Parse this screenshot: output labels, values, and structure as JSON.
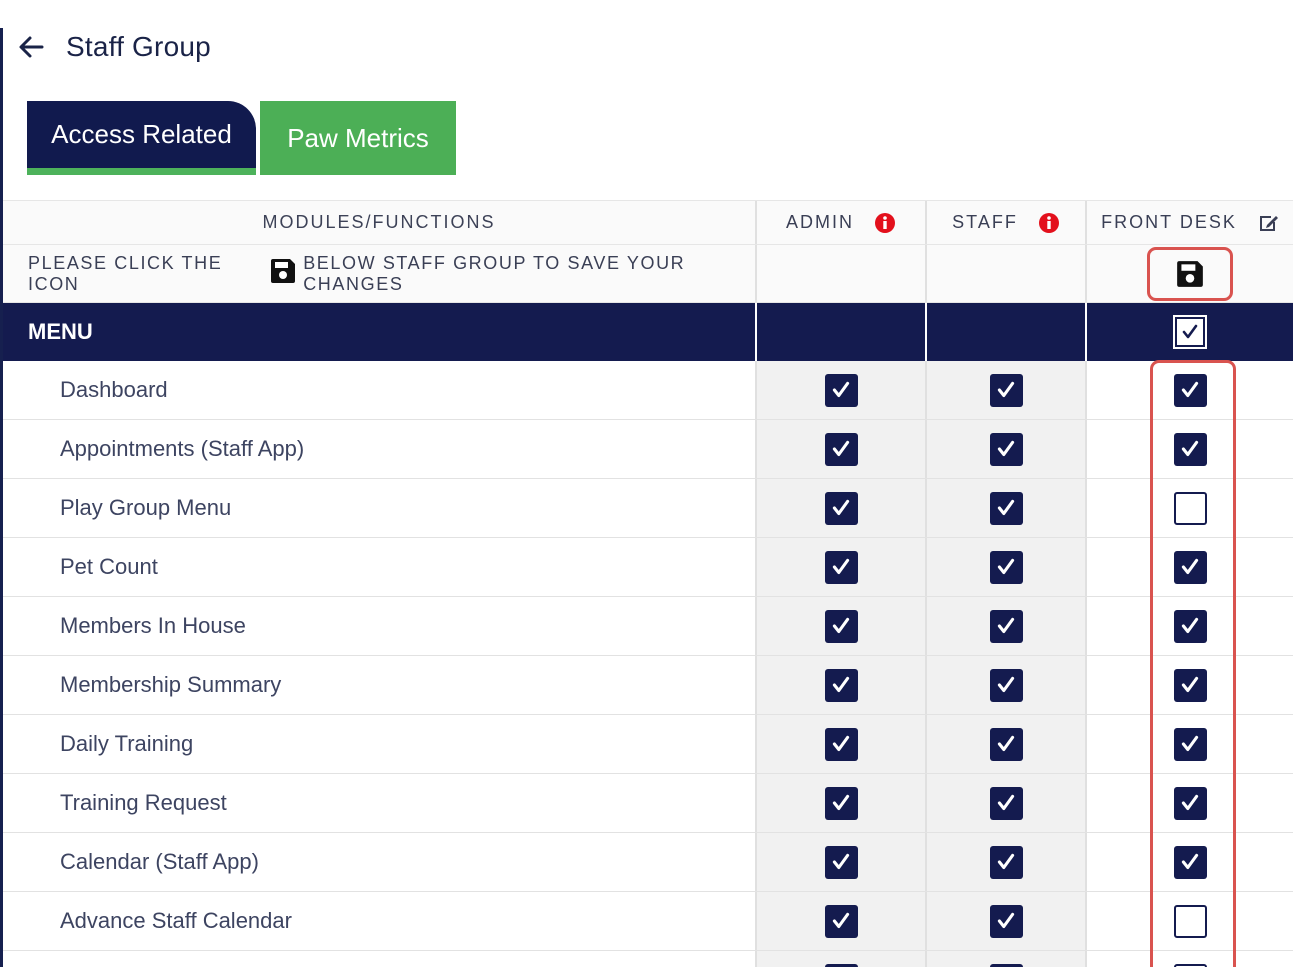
{
  "page": {
    "title": "Staff Group",
    "back_icon": "arrow-left-icon"
  },
  "tabs": [
    {
      "label": "Access Related",
      "active": true,
      "color": "#111a4e"
    },
    {
      "label": "Paw Metrics",
      "active": false,
      "color": "#4caf56"
    }
  ],
  "table": {
    "headers": {
      "modules": "MODULES/FUNCTIONS",
      "admin": "ADMIN",
      "staff": "STAFF",
      "front_desk": "FRONT DESK"
    },
    "save_notice": {
      "before": "PLEASE CLICK THE ICON",
      "after": "BELOW STAFF GROUP TO SAVE YOUR CHANGES"
    },
    "section": {
      "label": "MENU",
      "front_desk_checked": true
    },
    "rows": [
      {
        "label": "Dashboard",
        "admin": true,
        "staff": true,
        "front_desk": true
      },
      {
        "label": "Appointments (Staff App)",
        "admin": true,
        "staff": true,
        "front_desk": true
      },
      {
        "label": "Play Group Menu",
        "admin": true,
        "staff": true,
        "front_desk": false
      },
      {
        "label": "Pet Count",
        "admin": true,
        "staff": true,
        "front_desk": true
      },
      {
        "label": "Members In House",
        "admin": true,
        "staff": true,
        "front_desk": true
      },
      {
        "label": "Membership Summary",
        "admin": true,
        "staff": true,
        "front_desk": true
      },
      {
        "label": "Daily Training",
        "admin": true,
        "staff": true,
        "front_desk": true
      },
      {
        "label": "Training Request",
        "admin": true,
        "staff": true,
        "front_desk": true
      },
      {
        "label": "Calendar (Staff App)",
        "admin": true,
        "staff": true,
        "front_desk": true
      },
      {
        "label": "Advance Staff Calendar",
        "admin": true,
        "staff": true,
        "front_desk": false
      },
      {
        "label": "",
        "admin": true,
        "staff": true,
        "front_desk": false
      }
    ]
  },
  "colors": {
    "navy": "#141b4f",
    "green": "#4caf56",
    "highlight": "#d9534f",
    "info_red": "#e3101c"
  }
}
